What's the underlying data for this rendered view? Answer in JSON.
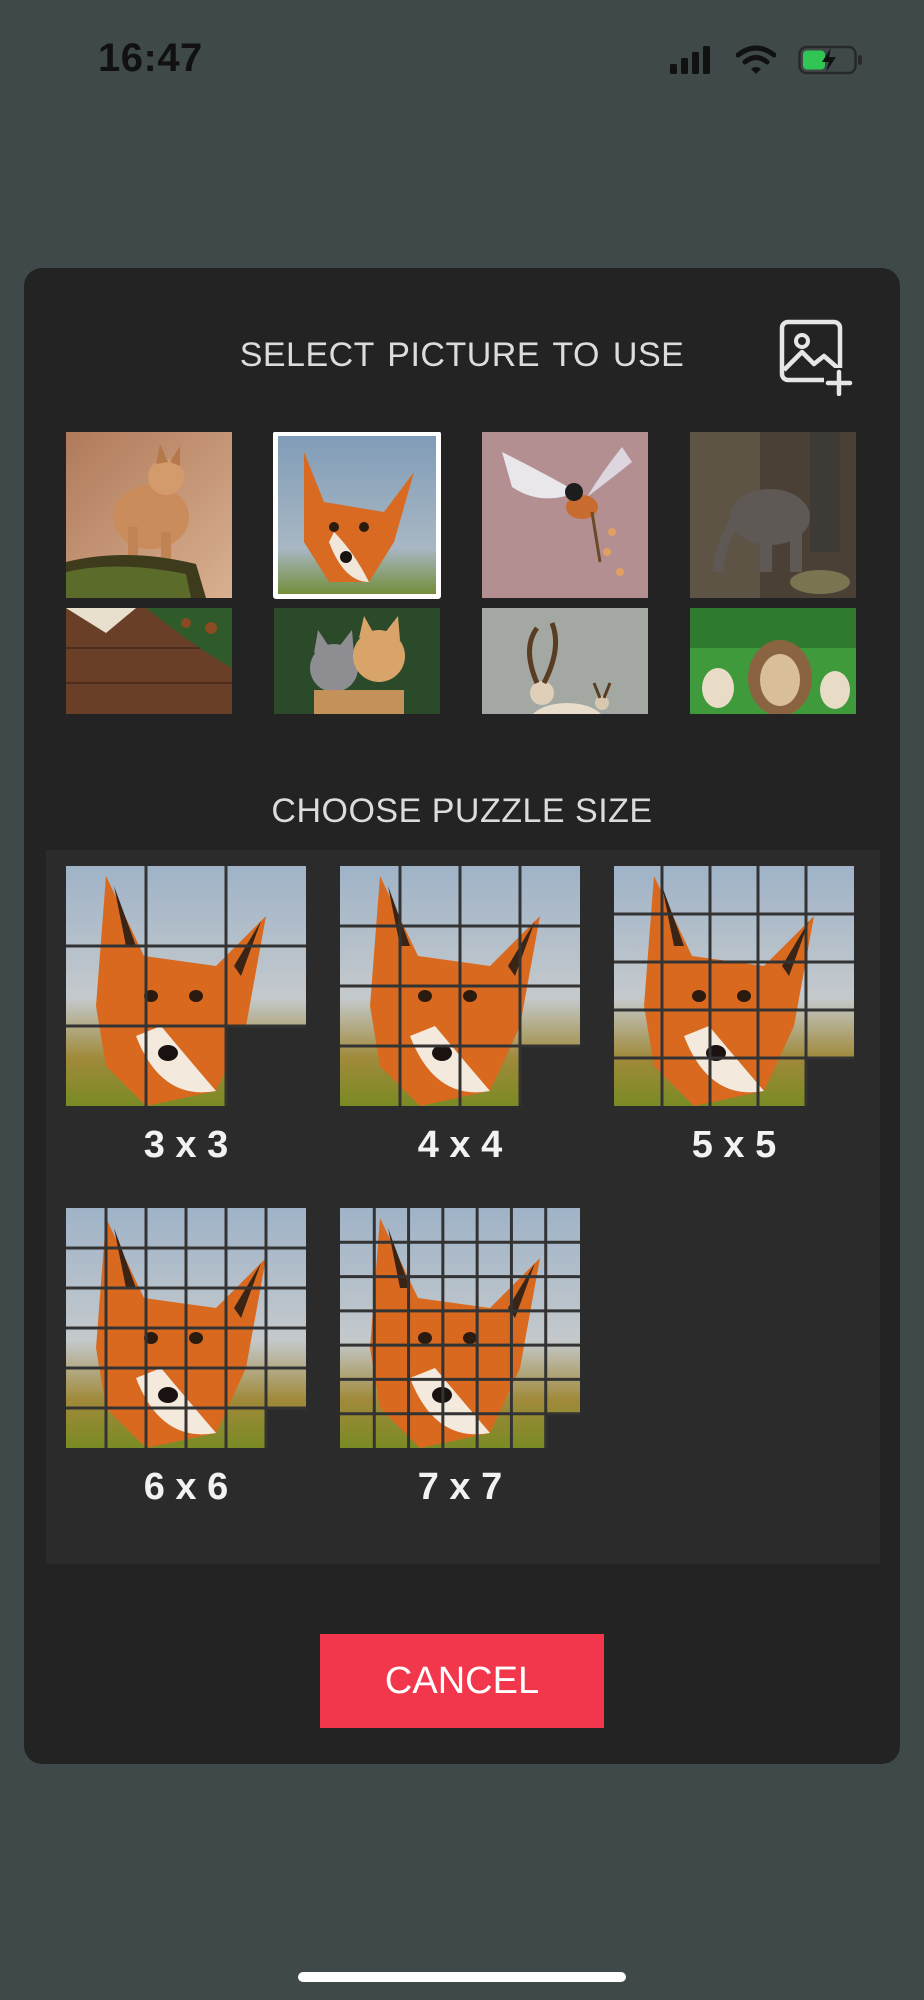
{
  "status_bar": {
    "time": "16:47",
    "battery_charging": true
  },
  "dialog": {
    "title": "SELECT  PICTURE TO USE",
    "add_image_icon": "image-add-icon",
    "pictures": [
      {
        "name": "fox-cub",
        "selected": false
      },
      {
        "name": "fox-portrait",
        "selected": true
      },
      {
        "name": "bird",
        "selected": false
      },
      {
        "name": "elephant",
        "selected": false
      },
      {
        "name": "wood-fir",
        "selected": false
      },
      {
        "name": "kittens",
        "selected": false
      },
      {
        "name": "deer",
        "selected": false
      },
      {
        "name": "lions",
        "selected": false
      }
    ],
    "size_title": "CHOOSE PUZZLE SIZE",
    "sizes": [
      {
        "label": "3 x 3",
        "n": 3
      },
      {
        "label": "4 x 4",
        "n": 4
      },
      {
        "label": "5 x 5",
        "n": 5
      },
      {
        "label": "6 x 6",
        "n": 6
      },
      {
        "label": "7 x 7",
        "n": 7
      }
    ],
    "cancel_label": "CANCEL"
  },
  "colors": {
    "accent": "#f2364b",
    "dialog_bg": "#232323",
    "page_bg": "#3f4949"
  }
}
